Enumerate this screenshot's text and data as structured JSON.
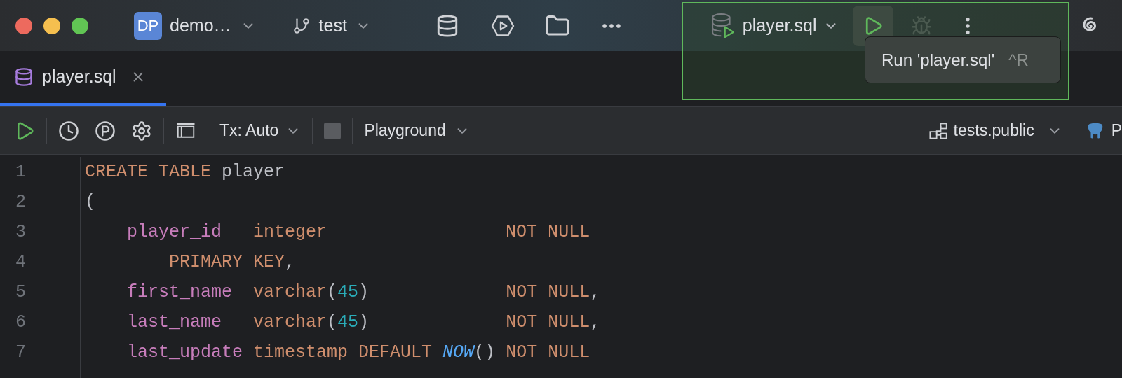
{
  "title_bar": {
    "project": {
      "initials": "DP",
      "name": "demo…"
    },
    "branch": "test",
    "run_config": "player.sql",
    "run_button": {
      "hovered": true
    },
    "debug_button": {
      "disabled": true
    }
  },
  "tooltip": {
    "text": "Run 'player.sql'",
    "shortcut": "^R"
  },
  "tabs": [
    {
      "label": "player.sql",
      "selected": true
    }
  ],
  "toolbar": {
    "tx_mode": "Tx: Auto",
    "stop_button": {
      "disabled": true
    },
    "session": "Playground",
    "schema": "tests.public",
    "datasource": "P"
  },
  "editor": {
    "lines": [
      {
        "number": "1",
        "tokens": [
          {
            "text": "CREATE TABLE ",
            "kind": "keyword"
          },
          {
            "text": "player",
            "kind": "plain"
          }
        ]
      },
      {
        "number": "2",
        "tokens": [
          {
            "text": "(",
            "kind": "plain"
          }
        ]
      },
      {
        "number": "3",
        "tokens": [
          {
            "text": "    player_id",
            "kind": "column"
          },
          {
            "text": "   integer                 NOT NULL",
            "kind": "keyword"
          }
        ]
      },
      {
        "number": "4",
        "tokens": [
          {
            "text": "        PRIMARY KEY",
            "kind": "keyword"
          },
          {
            "text": ",",
            "kind": "plain"
          }
        ]
      },
      {
        "number": "5",
        "tokens": [
          {
            "text": "    first_name",
            "kind": "column"
          },
          {
            "text": "  varchar",
            "kind": "keyword"
          },
          {
            "text": "(",
            "kind": "plain"
          },
          {
            "text": "45",
            "kind": "number"
          },
          {
            "text": ")",
            "kind": "plain"
          },
          {
            "text": "             NOT NULL",
            "kind": "keyword"
          },
          {
            "text": ",",
            "kind": "plain"
          }
        ]
      },
      {
        "number": "6",
        "tokens": [
          {
            "text": "    last_name",
            "kind": "column"
          },
          {
            "text": "   varchar",
            "kind": "keyword"
          },
          {
            "text": "(",
            "kind": "plain"
          },
          {
            "text": "45",
            "kind": "number"
          },
          {
            "text": ")",
            "kind": "plain"
          },
          {
            "text": "             NOT NULL",
            "kind": "keyword"
          },
          {
            "text": ",",
            "kind": "plain"
          }
        ]
      },
      {
        "number": "7",
        "tokens": [
          {
            "text": "    last_update",
            "kind": "column"
          },
          {
            "text": " timestamp DEFAULT ",
            "kind": "keyword"
          },
          {
            "text": "NOW",
            "kind": "function"
          },
          {
            "text": "() ",
            "kind": "plain"
          },
          {
            "text": "NOT NULL",
            "kind": "keyword"
          }
        ]
      }
    ]
  }
}
